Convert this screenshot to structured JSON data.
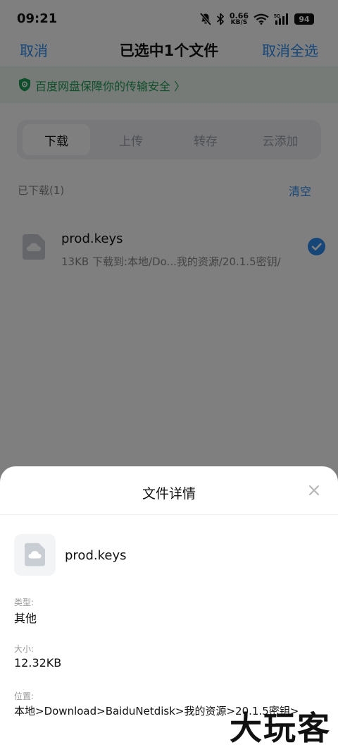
{
  "status_bar": {
    "time": "09:21",
    "speed_value": "0.66",
    "speed_unit": "KB/S",
    "network": "5G",
    "battery": "94"
  },
  "nav": {
    "cancel": "取消",
    "title": "已选中1个文件",
    "cancel_all": "取消全选"
  },
  "banner": {
    "text": "百度网盘保障你的传输安全 〉"
  },
  "tabs": [
    {
      "label": "下载",
      "active": true
    },
    {
      "label": "上传",
      "active": false
    },
    {
      "label": "转存",
      "active": false
    },
    {
      "label": "云添加",
      "active": false
    }
  ],
  "downloaded": {
    "label": "已下载(1)",
    "clear": "清空",
    "file": {
      "name": "prod.keys",
      "info": "13KB 下载到:本地/Do...我的资源/20.1.5密钥/",
      "checked": true
    }
  },
  "sheet": {
    "title": "文件详情",
    "file_name": "prod.keys",
    "type_label": "类型:",
    "type_value": "其他",
    "size_label": "大小:",
    "size_value": "12.32KB",
    "location_label": "位置:",
    "location_value": "本地>Download>BaiduNetdisk>我的资源>20.1.5密钥>"
  },
  "watermark": "大玩客",
  "colors": {
    "accent": "#2d8cf0",
    "banner_green": "#1f9c57"
  }
}
